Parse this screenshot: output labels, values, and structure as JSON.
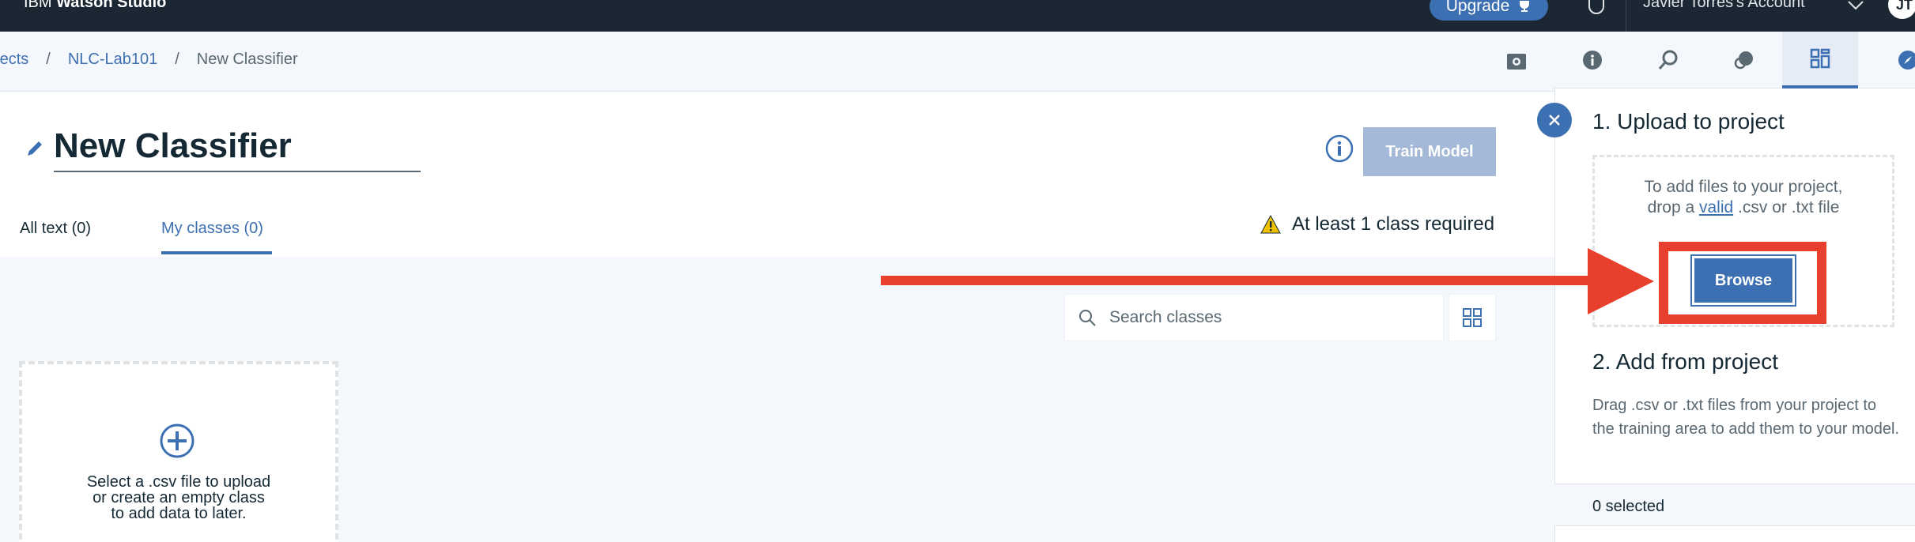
{
  "topbar": {
    "brand_ibm": "IBM",
    "brand_product": "Watson Studio",
    "upgrade_label": "Upgrade",
    "account_label": "Javier Torres's Account",
    "avatar_initials": "JT"
  },
  "breadcrumb": {
    "items": [
      "Projects",
      "NLC-Lab101",
      "New Classifier"
    ],
    "separator": "/"
  },
  "header": {
    "title": "New Classifier",
    "train_label": "Train Model",
    "warning": "At least 1 class required"
  },
  "tabs": {
    "all_text": "All text (0)",
    "my_classes": "My classes (0)"
  },
  "search": {
    "placeholder": "Search classes"
  },
  "empty_card": {
    "lines": [
      "Select a .csv file to upload",
      "or create an empty class",
      "to add data to later."
    ]
  },
  "panel": {
    "section1_title": "1. Upload to project",
    "drop_text_1": "To add files to your project,",
    "drop_text_2_pre": "drop a ",
    "drop_text_2_link": "valid",
    "drop_text_2_post": " .csv or .txt file",
    "browse_label": "Browse",
    "section2_title": "2. Add from project",
    "section2_desc": "Drag .csv or .txt files from your project to the training area to add them to your model.",
    "selected": "0 selected"
  },
  "colors": {
    "accent": "#3d70b2",
    "topbar": "#1b2834",
    "annotation_red": "#e8402c",
    "disabled_button": "#a4b9d8"
  }
}
